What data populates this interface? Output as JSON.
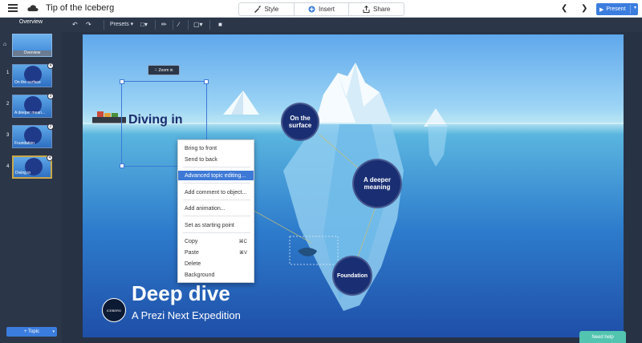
{
  "app": {
    "title": "Tip of the Iceberg"
  },
  "toolbar": {
    "tabs": [
      {
        "label": "Style"
      },
      {
        "label": "Insert"
      },
      {
        "label": "Share"
      }
    ],
    "back_icon": "chevron-left-icon",
    "forward_icon": "chevron-right-icon",
    "present_label": "Present"
  },
  "editbar": {
    "presets_label": "Presets ▾"
  },
  "sidebar": {
    "overview_label": "Overview",
    "overview_thumb_label": "Overview",
    "slides": [
      {
        "number": "1",
        "caption": "On the surface",
        "badge": "4"
      },
      {
        "number": "2",
        "caption": "A deeper mean...",
        "badge": "3"
      },
      {
        "number": "3",
        "caption": "Foundation",
        "badge": "2"
      },
      {
        "number": "4",
        "caption": "Diving in",
        "badge": "4"
      }
    ],
    "add_topic_label": "+ Topic"
  },
  "canvas": {
    "zoom_in_label": "Zoom in",
    "selected_topic_text": "Diving in",
    "topics": [
      {
        "label": "On the surface"
      },
      {
        "label": "A deeper meaning"
      },
      {
        "label": "Foundation"
      }
    ],
    "title": "Deep dive",
    "subtitle": "A Prezi Next Expedition",
    "logo_text": "ICEBERG"
  },
  "context_menu": {
    "items": [
      {
        "label": "Bring to front",
        "shortcut": ""
      },
      {
        "label": "Send to back",
        "shortcut": ""
      },
      {
        "label": "Advanced topic editing...",
        "shortcut": "",
        "highlighted": true
      },
      {
        "label": "Add comment to object...",
        "shortcut": ""
      },
      {
        "label": "Add animation...",
        "shortcut": ""
      },
      {
        "label": "Set as starting point",
        "shortcut": ""
      },
      {
        "label": "Copy",
        "shortcut": "⌘C"
      },
      {
        "label": "Paste",
        "shortcut": "⌘V"
      },
      {
        "label": "Delete",
        "shortcut": ""
      },
      {
        "label": "Background",
        "shortcut": ""
      }
    ]
  },
  "help": {
    "label": "Need help"
  },
  "colors": {
    "accent": "#3b7dde",
    "topic_circle": "#1a2f73",
    "help": "#52c4b0"
  }
}
